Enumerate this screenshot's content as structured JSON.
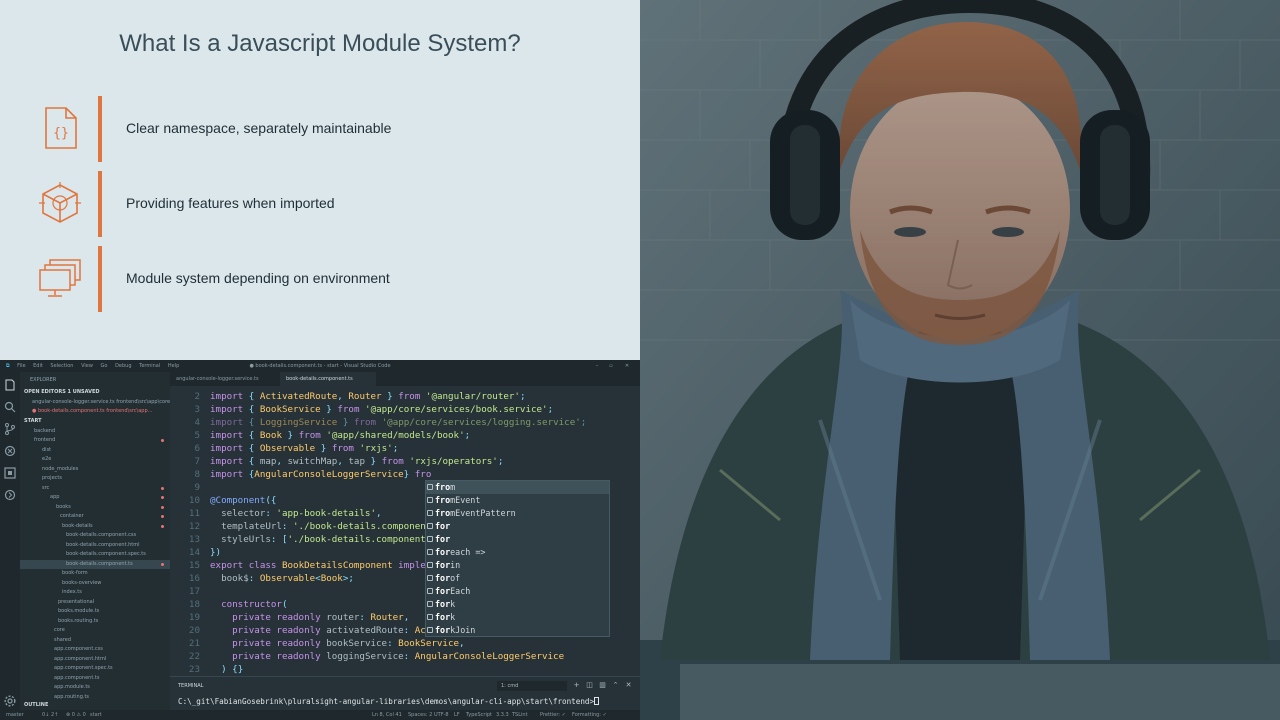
{
  "slide": {
    "title": "What Is a Javascript Module System?",
    "points": [
      {
        "icon": "code-file-icon",
        "text": "Clear namespace, separately maintainable"
      },
      {
        "icon": "package-cube-icon",
        "text": "Providing features when imported"
      },
      {
        "icon": "multiple-screens-icon",
        "text": "Module system depending on environment"
      }
    ],
    "accent": "#e0763f"
  },
  "vscode": {
    "menu": [
      "File",
      "Edit",
      "Selection",
      "View",
      "Go",
      "Debug",
      "Terminal",
      "Help"
    ],
    "window_title": "● book-details.component.ts - start - Visual Studio Code",
    "tabs": [
      {
        "label": "angular-console-logger.service.ts",
        "active": false
      },
      {
        "label": "book-details.component.ts",
        "active": true
      }
    ],
    "sidebar": {
      "header": "EXPLORER",
      "open_editors": "OPEN EDITORS   1 UNSAVED",
      "open_files": [
        "angular-console-logger.service.ts  frontend\\src\\app\\core\\...",
        "● book-details.component.ts  frontend\\src\\app..."
      ],
      "workspace": "START",
      "tree": [
        "backend",
        "frontend",
        "dist",
        "e2e",
        "node_modules",
        "projects",
        "src",
        "app",
        "books",
        "container",
        "book-details",
        "book-details.component.css",
        "book-details.component.html",
        "book-details.component.spec.ts",
        "book-details.component.ts",
        "book-form",
        "books-overview",
        "index.ts",
        "presentational",
        "books.module.ts",
        "books.routing.ts",
        "core",
        "shared",
        "app.component.css",
        "app.component.html",
        "app.component.spec.ts",
        "app.component.ts",
        "app.module.ts",
        "app.routing.ts"
      ],
      "outline": "OUTLINE"
    },
    "code_lines": [
      {
        "n": "2",
        "text": "import { ActivatedRoute, Router } from '@angular/router';"
      },
      {
        "n": "3",
        "text": "import { BookService } from '@app/core/services/book.service';"
      },
      {
        "n": "4",
        "text": "import { LoggingService } from '@app/core/services/logging.service';"
      },
      {
        "n": "5",
        "text": "import { Book } from '@app/shared/models/book';"
      },
      {
        "n": "6",
        "text": "import { Observable } from 'rxjs';"
      },
      {
        "n": "7",
        "text": "import { map, switchMap, tap } from 'rxjs/operators';"
      },
      {
        "n": "8",
        "text": "import {AngularConsoleLoggerService} fro"
      },
      {
        "n": "9",
        "text": ""
      },
      {
        "n": "10",
        "text": "@Component({"
      },
      {
        "n": "11",
        "text": "  selector: 'app-book-details',"
      },
      {
        "n": "12",
        "text": "  templateUrl: './book-details.component"
      },
      {
        "n": "13",
        "text": "  styleUrls: ['./book-details.component."
      },
      {
        "n": "14",
        "text": "})"
      },
      {
        "n": "15",
        "text": "export class BookDetailsComponent implem"
      },
      {
        "n": "16",
        "text": "  book$: Observable<Book>;"
      },
      {
        "n": "17",
        "text": ""
      },
      {
        "n": "18",
        "text": "  constructor("
      },
      {
        "n": "19",
        "text": "    private readonly router: Router,"
      },
      {
        "n": "20",
        "text": "    private readonly activatedRoute: Act"
      },
      {
        "n": "21",
        "text": "    private readonly bookService: BookService,"
      },
      {
        "n": "22",
        "text": "    private readonly loggingService: AngularConsoleLoggerService"
      },
      {
        "n": "23",
        "text": "  ) {}"
      }
    ],
    "suggestions": [
      {
        "match": "fro",
        "rest": "m",
        "selected": true
      },
      {
        "match": "fro",
        "rest": "mEvent",
        "selected": false
      },
      {
        "match": "fro",
        "rest": "mEventPattern",
        "selected": false
      },
      {
        "match": "for",
        "rest": "",
        "selected": false
      },
      {
        "match": "for",
        "rest": "",
        "selected": false
      },
      {
        "match": "for",
        "rest": "each =>",
        "selected": false
      },
      {
        "match": "for",
        "rest": "in",
        "selected": false
      },
      {
        "match": "for",
        "rest": "of",
        "selected": false
      },
      {
        "match": "for",
        "rest": "Each",
        "selected": false
      },
      {
        "match": "for",
        "rest": "k",
        "selected": false
      },
      {
        "match": "for",
        "rest": "k",
        "selected": false
      },
      {
        "match": "for",
        "rest": "kJoin",
        "selected": false
      }
    ],
    "panel": {
      "title": "TERMINAL",
      "terminal_select": "1: cmd",
      "prompt": "C:\\_git\\FabianGosebrink\\pluralsight-angular-libraries\\demos\\angular-cli-app\\start\\frontend>"
    },
    "status": {
      "branch": "master",
      "sync": "0↓ 2↑",
      "problems": "⊗ 0 ⚠ 0",
      "left_extra": "start",
      "position": "Ln 8, Col 41",
      "spaces": "Spaces: 2",
      "encoding": "UTF-8",
      "eol": "LF",
      "language": "TypeScript",
      "version": "3.3.3",
      "tslint": "TSLint",
      "prettier": "Prettier: ✓",
      "formatting": "Formatting: ✓"
    }
  }
}
